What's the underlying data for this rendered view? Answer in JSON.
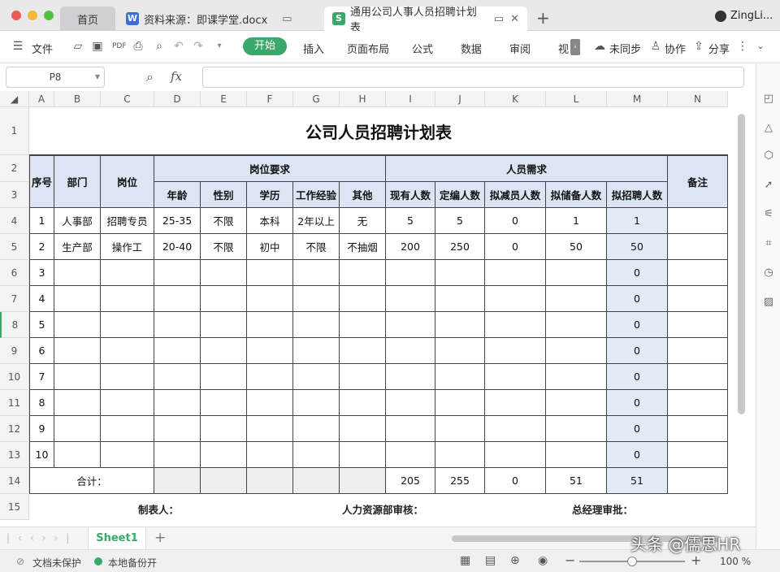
{
  "tabs": {
    "home": "首页",
    "doc": "资料来源：即课学堂.docx",
    "sheet": "通用公司人事人员招聘计划表",
    "user": "ZingLi..."
  },
  "menu": {
    "file": "文件",
    "start": "开始",
    "insert": "插入",
    "layout": "页面布局",
    "formula": "公式",
    "data": "数据",
    "review": "审阅",
    "view": "视",
    "sync": "未同步",
    "collab": "协作",
    "share": "分享"
  },
  "formula": {
    "cell_ref": "P8",
    "fx": "fx"
  },
  "columns": [
    "A",
    "B",
    "C",
    "D",
    "E",
    "F",
    "G",
    "H",
    "I",
    "J",
    "K",
    "L",
    "M",
    "N"
  ],
  "rows": [
    "1",
    "2",
    "3",
    "4",
    "5",
    "6",
    "7",
    "8",
    "9",
    "10",
    "11",
    "12",
    "13",
    "14",
    "15"
  ],
  "sheet": {
    "title": "公司人员招聘计划表",
    "h_no": "序号",
    "h_dept": "部门",
    "h_post": "岗位",
    "h_req": "岗位要求",
    "h_demand": "人员需求",
    "h_note": "备注",
    "h_age": "年龄",
    "h_gender": "性别",
    "h_edu": "学历",
    "h_exp": "工作经验",
    "h_other": "其他",
    "h_current": "现有人数",
    "h_quota": "定编人数",
    "h_reduce": "拟减员人数",
    "h_reserve": "拟储备人数",
    "h_hire": "拟招聘人数",
    "records": [
      [
        "1",
        "人事部",
        "招聘专员",
        "25-35",
        "不限",
        "本科",
        "2年以上",
        "无",
        "5",
        "5",
        "0",
        "1",
        "1",
        ""
      ],
      [
        "2",
        "生产部",
        "操作工",
        "20-40",
        "不限",
        "初中",
        "不限",
        "不抽烟",
        "200",
        "250",
        "0",
        "50",
        "50",
        ""
      ],
      [
        "3",
        "",
        "",
        "",
        "",
        "",
        "",
        "",
        "",
        "",
        "",
        "",
        "0",
        ""
      ],
      [
        "4",
        "",
        "",
        "",
        "",
        "",
        "",
        "",
        "",
        "",
        "",
        "",
        "0",
        ""
      ],
      [
        "5",
        "",
        "",
        "",
        "",
        "",
        "",
        "",
        "",
        "",
        "",
        "",
        "0",
        ""
      ],
      [
        "6",
        "",
        "",
        "",
        "",
        "",
        "",
        "",
        "",
        "",
        "",
        "",
        "0",
        ""
      ],
      [
        "7",
        "",
        "",
        "",
        "",
        "",
        "",
        "",
        "",
        "",
        "",
        "",
        "0",
        ""
      ],
      [
        "8",
        "",
        "",
        "",
        "",
        "",
        "",
        "",
        "",
        "",
        "",
        "",
        "0",
        ""
      ],
      [
        "9",
        "",
        "",
        "",
        "",
        "",
        "",
        "",
        "",
        "",
        "",
        "",
        "0",
        ""
      ],
      [
        "10",
        "",
        "",
        "",
        "",
        "",
        "",
        "",
        "",
        "",
        "",
        "",
        "0",
        ""
      ]
    ],
    "total_label": "合计：",
    "totals": [
      "205",
      "255",
      "0",
      "51",
      "51"
    ],
    "maker": "制表人：",
    "hr_review": "人力资源部审核：",
    "gm_approve": "总经理审批："
  },
  "sheet_tab": "Sheet1",
  "status": {
    "doc_protect": "文档未保护",
    "backup": "本地备份开",
    "zoom": "100 %",
    "watermark": "头条 @儒思HR"
  }
}
